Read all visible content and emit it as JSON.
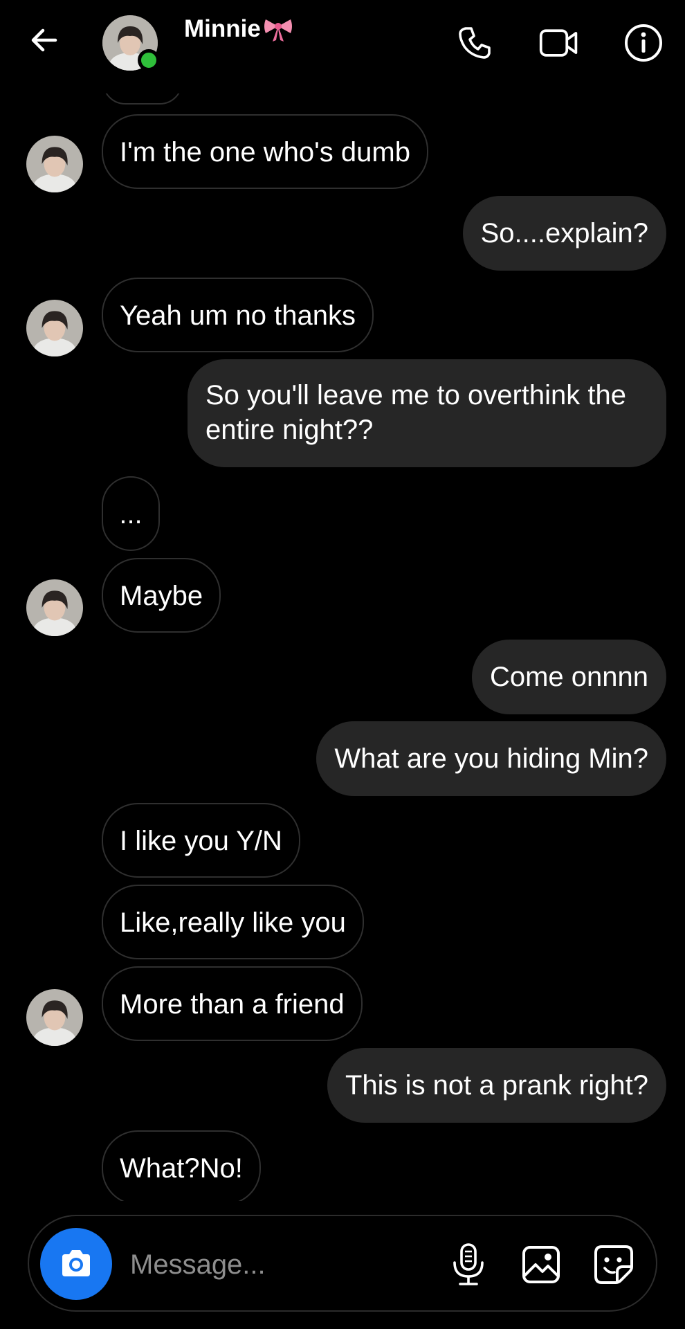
{
  "header": {
    "contact_name": "Minnie",
    "contact_emoji": "🎀",
    "online": true,
    "icons": [
      "back-arrow-icon",
      "phone-icon",
      "video-camera-icon",
      "info-icon"
    ],
    "online_color": "#2fbf3a"
  },
  "messages": [
    {
      "sender": "them",
      "text": "I'm the one who's dumb",
      "avatar": true
    },
    {
      "sender": "me",
      "text": "So....explain?"
    },
    {
      "sender": "them",
      "text": "Yeah um no thanks",
      "avatar": true
    },
    {
      "sender": "me",
      "text": "So you'll leave me to overthink the entire night??"
    },
    {
      "sender": "them",
      "text": "...",
      "avatar": false
    },
    {
      "sender": "them",
      "text": "Maybe",
      "avatar": true
    },
    {
      "sender": "me",
      "text": "Come onnnn"
    },
    {
      "sender": "me",
      "text": "What are you hiding Min?"
    },
    {
      "sender": "them",
      "text": "I like you Y/N",
      "avatar": false
    },
    {
      "sender": "them",
      "text": "Like,really like you",
      "avatar": false
    },
    {
      "sender": "them",
      "text": "More than a friend",
      "avatar": true
    },
    {
      "sender": "me",
      "text": "This is not a prank right?"
    },
    {
      "sender": "them",
      "text": "What?No!",
      "avatar": false
    }
  ],
  "composer": {
    "placeholder": "Message...",
    "icons": [
      "camera-icon",
      "microphone-icon",
      "gallery-icon",
      "sticker-icon"
    ],
    "camera_color": "#1877f2"
  },
  "colors": {
    "background": "#000000",
    "outgoing_bubble": "#262626",
    "incoming_border": "#2f2f2f"
  }
}
